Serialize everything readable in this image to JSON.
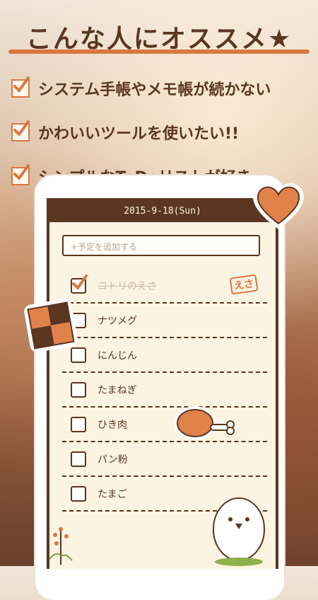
{
  "promo": {
    "title": "こんな人にオススメ★",
    "bullets": [
      "システム手帳やメモ帳が続かない",
      "かわいいツールを使いたい!!",
      "シンプルなToDoリストが好き"
    ]
  },
  "app": {
    "date": "2015-9-18(Sun)",
    "add_placeholder": "+予定を追加する",
    "todos": [
      {
        "label": "コトリのえさ",
        "done": true,
        "stamp": "えさ"
      },
      {
        "label": "ナツメグ",
        "done": false
      },
      {
        "label": "にんじん",
        "done": false
      },
      {
        "label": "たまねぎ",
        "done": false
      },
      {
        "label": "ひき肉",
        "done": false
      },
      {
        "label": "パン粉",
        "done": false
      },
      {
        "label": "たまご",
        "done": false
      }
    ]
  },
  "colors": {
    "brown": "#5b3621",
    "orange": "#d9773f",
    "paper": "#fbf4e2"
  },
  "icons": [
    "heart-sticker-icon",
    "checker-cookie-icon",
    "meat-sticker-icon",
    "bird-mascot-icon",
    "plant-icon"
  ]
}
